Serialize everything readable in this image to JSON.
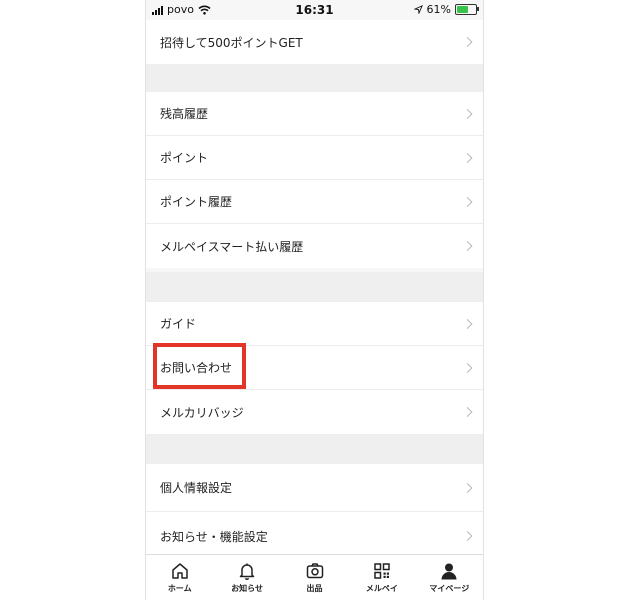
{
  "status_bar": {
    "carrier": "povo",
    "time": "16:31",
    "battery_percent": "61%"
  },
  "top_item": {
    "label": "招待して500ポイントGET"
  },
  "section_payments": {
    "items": [
      {
        "label": "残高履歴"
      },
      {
        "label": "ポイント"
      },
      {
        "label": "ポイント履歴"
      },
      {
        "label": "メルペイスマート払い履歴"
      }
    ]
  },
  "section_help": {
    "items": [
      {
        "label": "ガイド"
      },
      {
        "label": "お問い合わせ"
      },
      {
        "label": "メルカリバッジ"
      }
    ]
  },
  "section_settings": {
    "items": [
      {
        "label": "個人情報設定"
      },
      {
        "label": "お知らせ・機能設定"
      }
    ]
  },
  "highlight_color": "#e3342a",
  "tab_bar": {
    "tabs": [
      {
        "label": "ホーム",
        "icon": "home-icon"
      },
      {
        "label": "お知らせ",
        "icon": "bell-icon"
      },
      {
        "label": "出品",
        "icon": "camera-icon"
      },
      {
        "label": "メルペイ",
        "icon": "qr-code-icon"
      },
      {
        "label": "マイページ",
        "icon": "person-icon"
      }
    ]
  }
}
